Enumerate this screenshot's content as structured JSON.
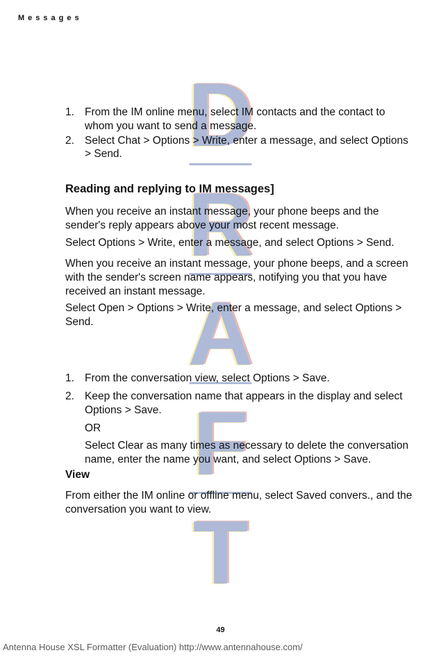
{
  "header": {
    "label": "Messages"
  },
  "watermark": {
    "letters": [
      "D",
      "R",
      "A",
      "F",
      "T"
    ]
  },
  "ol1": {
    "items": [
      "From the IM online menu, select IM contacts and the contact to whom you want to send a message.",
      "Select Chat > Options > Write, enter a message, and select Options > Send."
    ]
  },
  "section1": {
    "heading": "Reading and replying to IM messages]",
    "p1": "When you receive an instant message, your phone beeps and the sender's reply appears above your most recent message.",
    "p2": "Select Options > Write, enter a message, and select Options > Send.",
    "p3": "When you receive an instant message, your phone beeps, and a screen with the sender's screen name appears, notifying you that you have received an instant message.",
    "p4": "Select Open > Options > Write, enter a message, and select Options > Send."
  },
  "ol2": {
    "items": [
      "From the conversation view, select Options > Save.",
      "Keep the conversation name that appears in the display and select Options > Save."
    ],
    "or": "OR",
    "alt": "Select Clear as many times as necessary to delete the conversation name, enter the name you want, and select Options > Save."
  },
  "section2": {
    "heading": "View",
    "p1": "From either the IM online or offline menu, select Saved convers., and the conversation you want to view."
  },
  "footer": {
    "page": "49",
    "line": "Antenna House XSL Formatter (Evaluation)  http://www.antennahouse.com/"
  }
}
